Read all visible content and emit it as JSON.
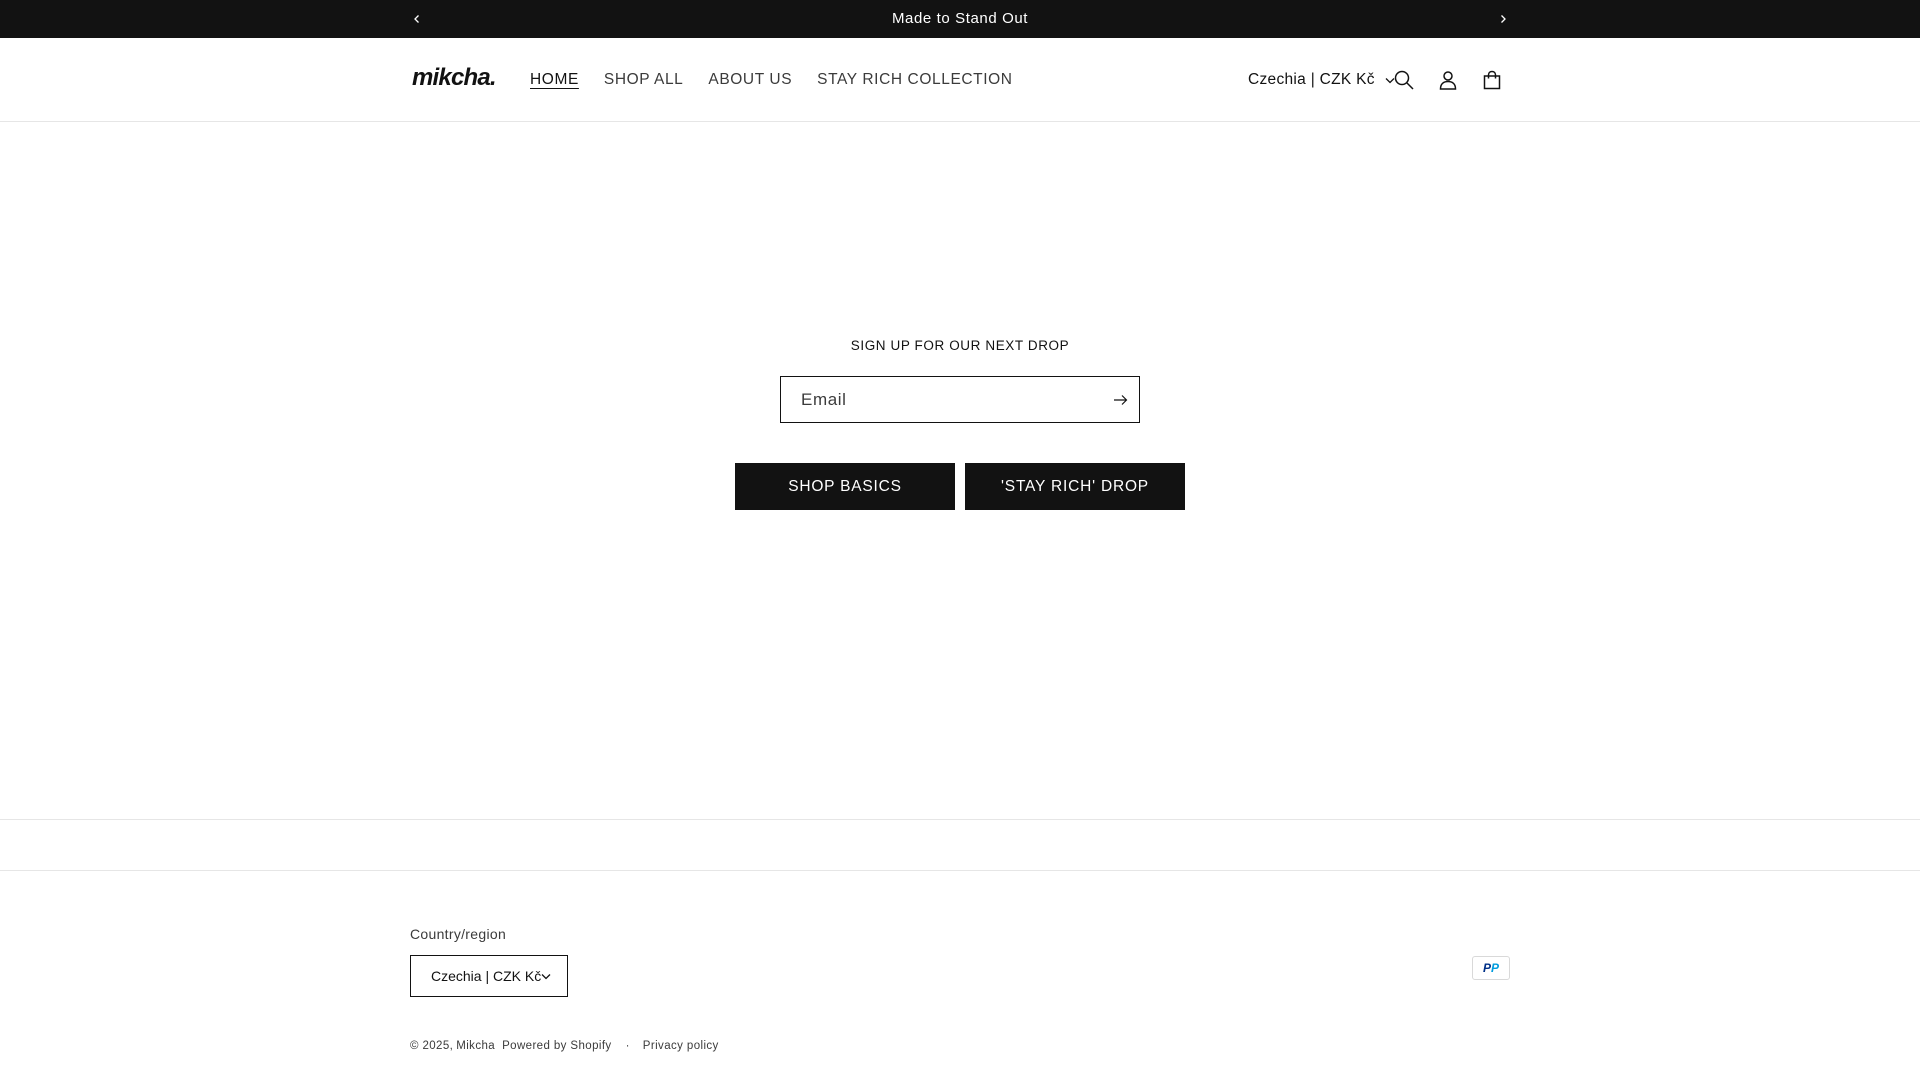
{
  "announcement": {
    "text": "Made to Stand Out"
  },
  "header": {
    "logo": "mikcha.",
    "nav": [
      {
        "label": "HOME",
        "active": true
      },
      {
        "label": "SHOP ALL"
      },
      {
        "label": "ABOUT US"
      },
      {
        "label": "STAY RICH COLLECTION"
      }
    ],
    "region": "Czechia | CZK Kč",
    "icons": [
      "search-icon",
      "account-icon",
      "cart-icon"
    ]
  },
  "newsletter": {
    "title": "SIGN UP FOR OUR NEXT DROP",
    "email_placeholder": "Email"
  },
  "buttons": {
    "basics": "SHOP BASICS",
    "drop": "'STAY RICH' DROP"
  },
  "footer": {
    "country_label": "Country/region",
    "country_value": "Czechia | CZK Kč",
    "payment": {
      "brand": "P",
      "brand_accent": "P"
    },
    "copyright_prefix": "© 2025,",
    "store_name": "Mikcha",
    "powered_by": "Powered by Shopify",
    "separator": "·",
    "privacy": "Privacy policy"
  },
  "colors": {
    "dark": "#121212",
    "text_muted": "#3b3b3b",
    "border": "#e6e6e6",
    "paypal_dark": "#003087",
    "paypal_light": "#009cde"
  }
}
